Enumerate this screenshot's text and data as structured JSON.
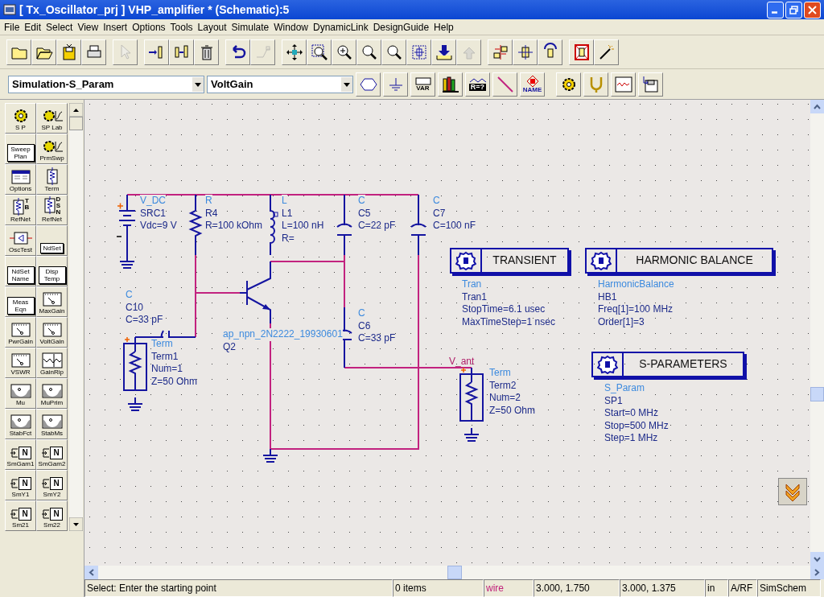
{
  "window": {
    "title": "[ Tx_Oscillator_prj ] VHP_amplifier * (Schematic):5"
  },
  "menu": [
    "File",
    "Edit",
    "Select",
    "View",
    "Insert",
    "Options",
    "Tools",
    "Layout",
    "Simulate",
    "Window",
    "DynamicLink",
    "DesignGuide",
    "Help"
  ],
  "toolbar": [
    {
      "disabled": false
    },
    {
      "disabled": false
    },
    {
      "disabled": false
    },
    {
      "disabled": false
    },
    {
      "disabled": true
    },
    {
      "disabled": false
    },
    {
      "disabled": false
    },
    {
      "disabled": false
    },
    {
      "disabled": false
    },
    {
      "disabled": true
    },
    {
      "disabled": false
    },
    {
      "disabled": false
    },
    {
      "disabled": false
    },
    {
      "disabled": false
    },
    {
      "disabled": false
    },
    {
      "disabled": false
    },
    {
      "disabled": false
    },
    {
      "disabled": true
    },
    {
      "disabled": false
    },
    {
      "disabled": false
    },
    {
      "disabled": false
    },
    {
      "disabled": false
    },
    {
      "disabled": false
    }
  ],
  "palette_select": {
    "value": "Simulation-S_Param"
  },
  "component_select": {
    "value": "VoltGain"
  },
  "toolbar2": [
    {
      "kind": "port"
    },
    {
      "kind": "ground"
    },
    {
      "kind": "var",
      "label": "VAR"
    },
    {
      "kind": "bars"
    },
    {
      "kind": "eqn",
      "label": "R=?"
    },
    {
      "kind": "wire"
    },
    {
      "kind": "name",
      "label": "NAME"
    },
    {
      "kind": "gear"
    },
    {
      "kind": "fork"
    },
    {
      "kind": "wave"
    },
    {
      "kind": "disk"
    }
  ],
  "palette": [
    {
      "kind": "icon",
      "label": "S P"
    },
    {
      "kind": "icon",
      "label": "SP Lab"
    },
    {
      "kind": "box",
      "text": "Sweep Plan"
    },
    {
      "kind": "icon",
      "label": "PrmSwp"
    },
    {
      "kind": "icon",
      "label": "Options"
    },
    {
      "kind": "icon",
      "label": "Term"
    },
    {
      "kind": "icon",
      "tag": "TB",
      "label": "RefNet"
    },
    {
      "kind": "icon",
      "tag": "DSN",
      "label": "RefNet"
    },
    {
      "kind": "icon",
      "label": "OscTest"
    },
    {
      "kind": "box",
      "text": "NdSet"
    },
    {
      "kind": "box",
      "text": "NdSet Name"
    },
    {
      "kind": "box",
      "text": "Disp Temp"
    },
    {
      "kind": "box",
      "text": "Meas Eqn"
    },
    {
      "kind": "icon",
      "label": "MaxGain"
    },
    {
      "kind": "icon",
      "label": "PwrGain"
    },
    {
      "kind": "icon",
      "label": "VoltGain"
    },
    {
      "kind": "icon",
      "label": "VSWR"
    },
    {
      "kind": "icon",
      "label": "GainRip"
    },
    {
      "kind": "icon",
      "label": "Mu"
    },
    {
      "kind": "icon",
      "label": "MuPrim"
    },
    {
      "kind": "icon",
      "label": "StabFct"
    },
    {
      "kind": "icon",
      "label": "StabMs"
    },
    {
      "kind": "icon",
      "tag": "N",
      "label": "SmGam1"
    },
    {
      "kind": "icon",
      "tag": "N",
      "label": "SmGam2"
    },
    {
      "kind": "icon",
      "tag": "N",
      "label": "SmY1"
    },
    {
      "kind": "icon",
      "tag": "N",
      "label": "SmY2"
    },
    {
      "kind": "icon",
      "tag": "N",
      "label": "Sm21"
    },
    {
      "kind": "icon",
      "tag": "N",
      "label": "Sm22"
    }
  ],
  "components": [
    {
      "type": "V_DC",
      "name": "SRC1",
      "params": [
        "Vdc=9 V"
      ]
    },
    {
      "type": "R",
      "name": "R4",
      "params": [
        "R=100 kOhm"
      ]
    },
    {
      "type": "L",
      "name": "L1",
      "params": [
        "L=100 nH",
        "R="
      ]
    },
    {
      "type": "C",
      "name": "C5",
      "params": [
        "C=22 pF"
      ]
    },
    {
      "type": "C",
      "name": "C7",
      "params": [
        "C=100 nF"
      ]
    },
    {
      "type": "C",
      "name": "C10",
      "params": [
        "C=33 pF"
      ]
    },
    {
      "type": "Term",
      "name": "Term1",
      "params": [
        "Num=1",
        "Z=50 Ohm"
      ]
    },
    {
      "type": "ap_npn_2N2222_19930601",
      "name": "Q2"
    },
    {
      "type": "C",
      "name": "C6",
      "params": [
        "C=33 pF"
      ]
    },
    {
      "type": "Term",
      "name": "Term2",
      "params": [
        "Num=2",
        "Z=50 Ohm"
      ]
    }
  ],
  "net_label": "V_ant",
  "controllers": [
    {
      "title": "TRANSIENT",
      "type": "Tran",
      "name": "Tran1",
      "params": [
        "StopTime=6.1 usec",
        "MaxTimeStep=1 nsec"
      ]
    },
    {
      "title": "HARMONIC BALANCE",
      "type": "HarmonicBalance",
      "name": "HB1",
      "params": [
        "Freq[1]=100 MHz",
        "Order[1]=3"
      ]
    },
    {
      "title": "S-PARAMETERS",
      "type": "S_Param",
      "name": "SP1",
      "params": [
        "Start=0 MHz",
        "Stop=500 MHz",
        "Step=1 MHz"
      ]
    }
  ],
  "status_bar": [
    {
      "kind": "text",
      "text": "Select: Enter the starting point"
    },
    {
      "kind": "text",
      "text": "0 items"
    },
    {
      "kind": "mode",
      "text": "wire"
    },
    {
      "kind": "text",
      "text": "3.000, 1.750"
    },
    {
      "kind": "text",
      "text": "3.000, 1.375"
    },
    {
      "kind": "text",
      "text": "in"
    },
    {
      "kind": "text",
      "text": "A/RF"
    },
    {
      "kind": "text",
      "text": "SimSchem"
    }
  ]
}
